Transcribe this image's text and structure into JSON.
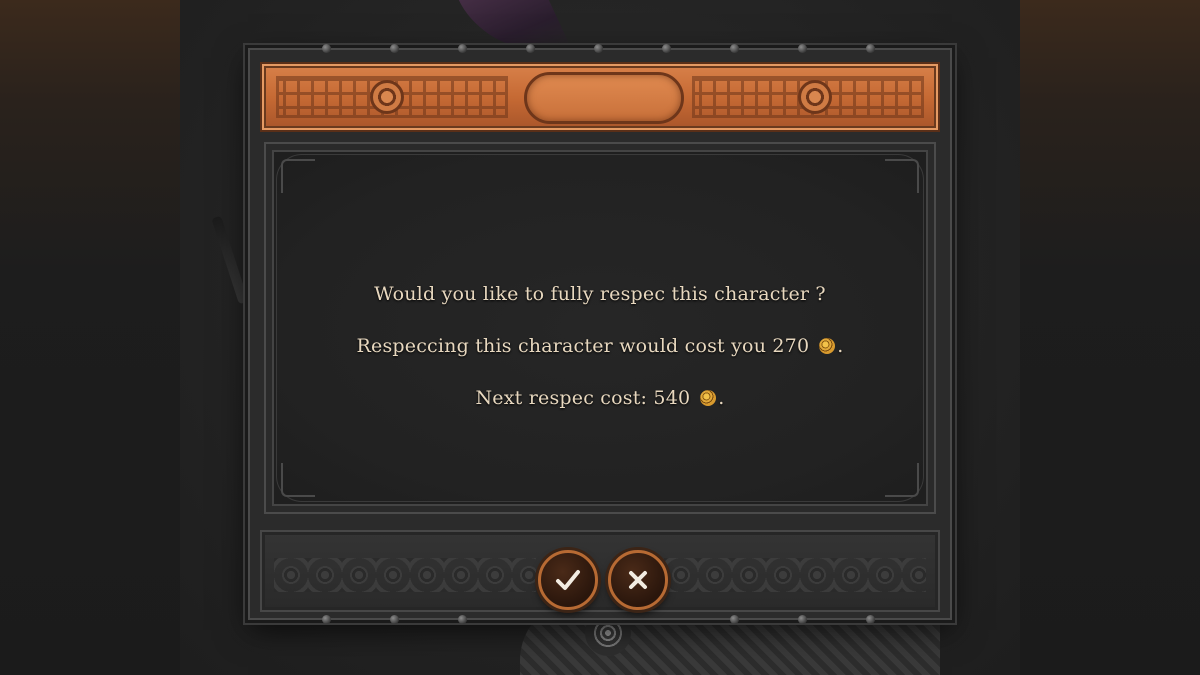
{
  "dialog": {
    "message": {
      "question": "Would you like to fully respec this character ?",
      "cost_text": "Respeccing this character would cost you 270",
      "next_cost_text": "Next respec cost: 540",
      "period": "."
    },
    "currency_icon": "gold-coin-icon",
    "buttons": {
      "confirm_icon": "checkmark-icon",
      "cancel_icon": "x-close-icon"
    }
  },
  "colors": {
    "header_band": "#c66a34",
    "text": "#e8d8bf",
    "button_ring": "#b76a33",
    "coin": "#e1a83a"
  }
}
